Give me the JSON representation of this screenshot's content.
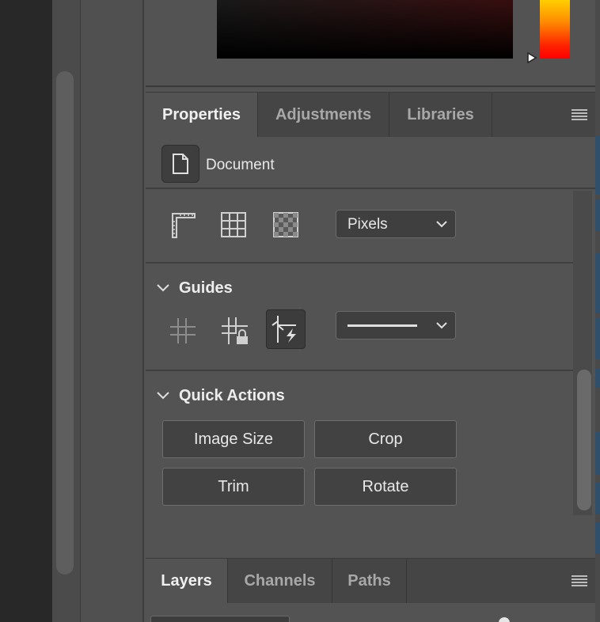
{
  "properties_panel": {
    "tabs": [
      {
        "label": "Properties",
        "active": true
      },
      {
        "label": "Adjustments",
        "active": false
      },
      {
        "label": "Libraries",
        "active": false
      }
    ],
    "document_label": "Document",
    "units_select": {
      "value": "Pixels"
    },
    "guides": {
      "title": "Guides",
      "smart_guides_active": true,
      "line_style": "solid"
    },
    "quick_actions": {
      "title": "Quick Actions",
      "buttons": [
        "Image Size",
        "Crop",
        "Trim",
        "Rotate"
      ]
    }
  },
  "layers_panel": {
    "tabs": [
      {
        "label": "Layers",
        "active": true
      },
      {
        "label": "Channels",
        "active": false
      },
      {
        "label": "Paths",
        "active": false
      }
    ]
  },
  "colors": {
    "panel_bg": "#535353",
    "tabbar_bg": "#454545",
    "hue_top": "#ffd800",
    "hue_bottom": "#ff0000",
    "accent_strip": "#2f4f6a"
  },
  "icons": [
    "ruler-icon",
    "grid-icon",
    "transparency-icon",
    "guides-icon",
    "lock-guides-icon",
    "smart-guides-icon",
    "document-icon",
    "panel-menu-icon",
    "chevron-down-icon"
  ]
}
